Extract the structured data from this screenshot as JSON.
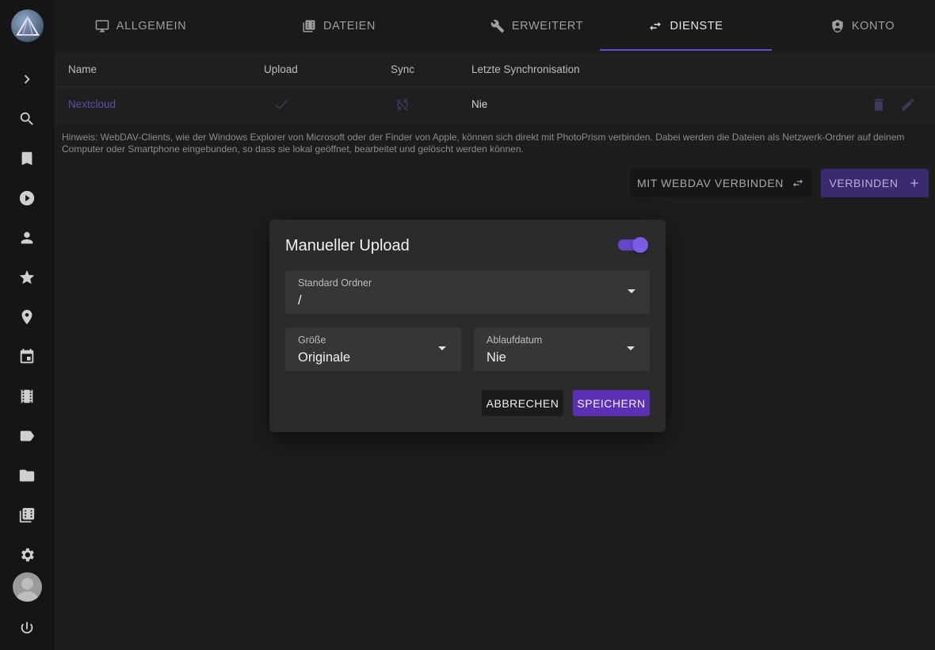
{
  "tabs": [
    {
      "label": "ALLGEMEIN",
      "icon": "monitor-icon"
    },
    {
      "label": "DATEIEN",
      "icon": "film-library-icon"
    },
    {
      "label": "ERWEITERT",
      "icon": "wrench-icon"
    },
    {
      "label": "DIENSTE",
      "icon": "swap-icon",
      "active": true
    },
    {
      "label": "KONTO",
      "icon": "account-shield-icon"
    }
  ],
  "sidebar": {
    "items": [
      "expand",
      "search",
      "albums",
      "videos",
      "people",
      "favorites",
      "places",
      "calendar",
      "moments",
      "labels",
      "folders",
      "library",
      "settings",
      "account",
      "logout"
    ]
  },
  "table": {
    "headers": {
      "name": "Name",
      "upload": "Upload",
      "sync": "Sync",
      "last_sync": "Letzte Synchronisation"
    },
    "rows": [
      {
        "name": "Nextcloud",
        "upload": "check",
        "sync": "sync-off",
        "last_sync": "Nie"
      }
    ]
  },
  "hint": "Hinweis: WebDAV-Clients, wie der Windows Explorer von Microsoft oder der Finder von Apple, können sich direkt mit PhotoPrism verbinden. Dabei werden die Dateien als Netzwerk-Ordner auf deinem Computer oder Smartphone eingebunden, so dass sie lokal geöffnet, bearbeitet und gelöscht werden können.",
  "actions": {
    "webdav_label": "MIT WEBDAV VERBINDEN",
    "connect_label": "VERBINDEN"
  },
  "dialog": {
    "title": "Manueller Upload",
    "enabled": true,
    "folder": {
      "label": "Standard Ordner",
      "value": "/"
    },
    "size": {
      "label": "Größe",
      "value": "Originale"
    },
    "expires": {
      "label": "Ablaufdatum",
      "value": "Nie"
    },
    "cancel_label": "ABBRECHEN",
    "save_label": "SPEICHERN"
  },
  "colors": {
    "accent": "#5b30b5",
    "link": "#5a4fb0",
    "background": "#1d1d1d"
  }
}
